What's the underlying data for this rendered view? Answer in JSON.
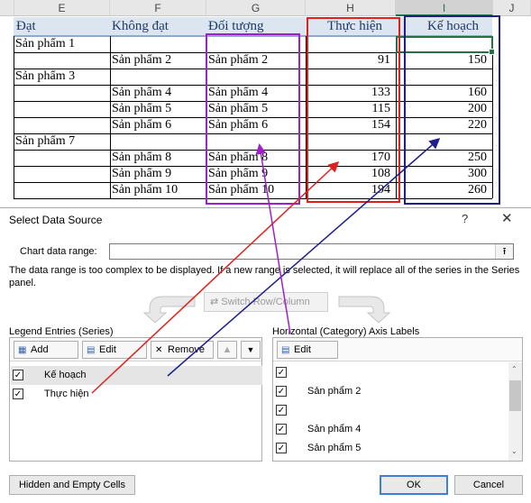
{
  "sheet": {
    "columns": [
      "E",
      "F",
      "G",
      "H",
      "I",
      "J"
    ],
    "headers": {
      "e": "Đạt",
      "f": "Không đạt",
      "g": "Đối tượng",
      "h": "Thực hiện",
      "i": "Kế hoạch"
    },
    "rows": [
      {
        "e": "Sản phẩm 1",
        "f": "",
        "g": "",
        "h": "",
        "i": ""
      },
      {
        "e": "",
        "f": "Sản phẩm 2",
        "g": "Sản phẩm 2",
        "h": "91",
        "i": "150"
      },
      {
        "e": "Sản phẩm 3",
        "f": "",
        "g": "",
        "h": "",
        "i": ""
      },
      {
        "e": "",
        "f": "Sản phẩm 4",
        "g": "Sản phẩm 4",
        "h": "133",
        "i": "160"
      },
      {
        "e": "",
        "f": "Sản phẩm 5",
        "g": "Sản phẩm 5",
        "h": "115",
        "i": "200"
      },
      {
        "e": "",
        "f": "Sản phẩm 6",
        "g": "Sản phẩm 6",
        "h": "154",
        "i": "220"
      },
      {
        "e": "Sản phẩm 7",
        "f": "",
        "g": "",
        "h": "",
        "i": ""
      },
      {
        "e": "",
        "f": "Sản phẩm 8",
        "g": "Sản phẩm 8",
        "h": "170",
        "i": "250"
      },
      {
        "e": "",
        "f": "Sản phẩm 9",
        "g": "Sản phẩm 9",
        "h": "108",
        "i": "300"
      },
      {
        "e": "",
        "f": "Sản phẩm 10",
        "g": "Sản phẩm 10",
        "h": "194",
        "i": "260"
      }
    ],
    "colors": {
      "purple": "#a020c8",
      "red": "#e0201c",
      "navy": "#1e1e8c",
      "excel_green": "#217346"
    }
  },
  "dialog": {
    "title": "Select Data Source",
    "help": "?",
    "close": "✕",
    "range_label": "Chart data range:",
    "range_value": "",
    "range_button": "⭱",
    "message": "The data range is too complex to be displayed. If a new range is selected, it will replace all of the series in the Series panel.",
    "switch_label": "Switch Row/Column",
    "legend": {
      "title": "Legend Entries (Series)",
      "add": "Add",
      "edit": "Edit",
      "remove": "Remove",
      "up": "▲",
      "down": "▼",
      "series": [
        {
          "name": "Kế hoạch",
          "checked": "✓"
        },
        {
          "name": "Thực hiện",
          "checked": "✓"
        }
      ]
    },
    "axis": {
      "title": "Horizontal (Category) Axis Labels",
      "edit": "Edit",
      "items": [
        {
          "label": "",
          "checked": "✓"
        },
        {
          "label": "Sản phẩm 2",
          "checked": "✓"
        },
        {
          "label": "",
          "checked": "✓"
        },
        {
          "label": "Sản phẩm 4",
          "checked": "✓"
        },
        {
          "label": "Sản phẩm 5",
          "checked": "✓"
        }
      ]
    },
    "hidden_cells": "Hidden and Empty Cells",
    "ok": "OK",
    "cancel": "Cancel"
  }
}
